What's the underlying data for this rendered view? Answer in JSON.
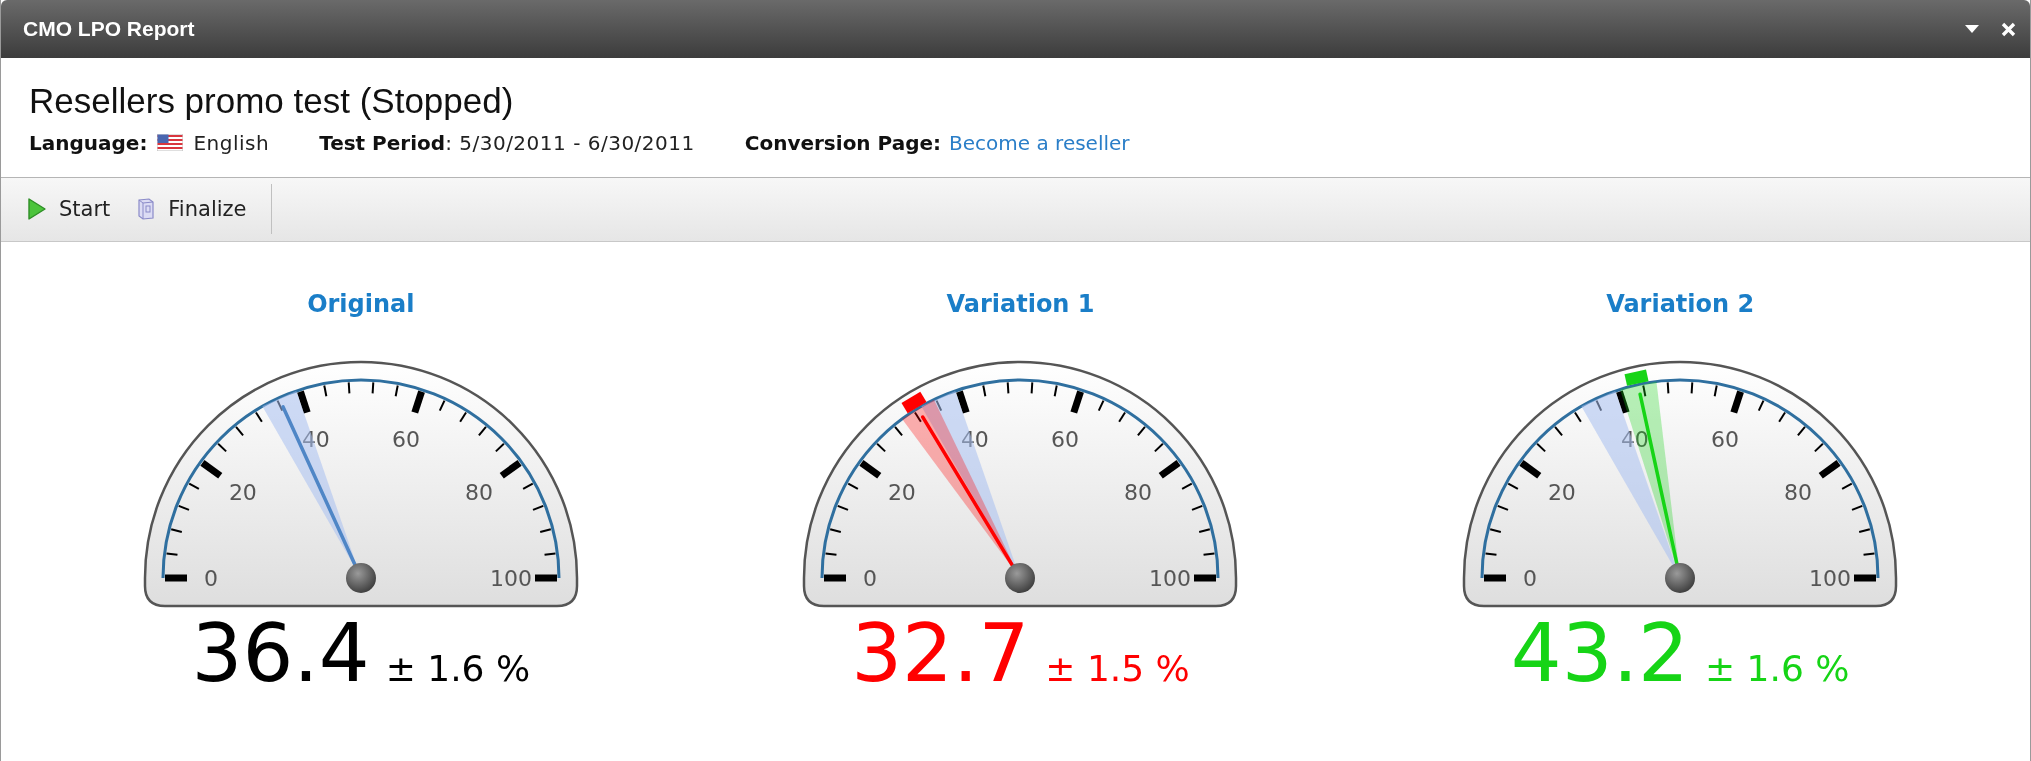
{
  "window": {
    "title": "CMO LPO Report"
  },
  "header": {
    "title": "Resellers promo test (Stopped)",
    "fields": [
      {
        "kind": "language",
        "label": "Language:",
        "value": "English"
      },
      {
        "kind": "text",
        "label": "Test Period",
        "value": ": 5/30/2011 - 6/30/2011"
      },
      {
        "kind": "link",
        "label": "Conversion Page:",
        "value": "Become a reseller"
      }
    ]
  },
  "toolbar": [
    {
      "kind": "start",
      "label": "Start"
    },
    {
      "kind": "finalize",
      "label": "Finalize"
    }
  ],
  "gauges": [
    {
      "title": "Original",
      "kind": "baseline",
      "level": 0.364,
      "value": "36.4",
      "margin": "± 1.6 %",
      "color": "#000000",
      "scale_labels": [
        "0",
        "20",
        "40",
        "60",
        "80",
        "100"
      ]
    },
    {
      "title": "Variation 1",
      "kind": "variation",
      "level": 0.327,
      "value": "32.7",
      "margin": "± 1.5 %",
      "color": "#ff0000",
      "scale_labels": [
        "0",
        "20",
        "40",
        "60",
        "80",
        "100"
      ]
    },
    {
      "title": "Variation 2",
      "kind": "variation",
      "level": 0.432,
      "value": "43.2",
      "margin": "± 1.6 %",
      "color": "#16d416",
      "scale_labels": [
        "0",
        "20",
        "40",
        "60",
        "80",
        "100"
      ]
    }
  ]
}
